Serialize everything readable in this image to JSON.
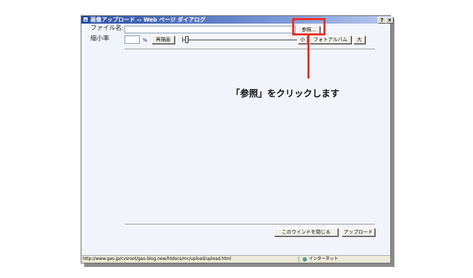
{
  "window": {
    "title": "画像アップロード -- Web ページ ダイアログ",
    "help_button": "?",
    "close_button": "×"
  },
  "form": {
    "file_label": "ファイル名:",
    "file_value": "",
    "browse_label": "参照...",
    "scale_label": "縮小率",
    "scale_value": "",
    "percent_unit": "%",
    "redraw_label": "再描画",
    "small_label": "小",
    "photo_album_label": "フォトアルバム",
    "large_label": "大"
  },
  "footer": {
    "close_window_label": "このウインドを閉じる",
    "upload_label": "アップロード"
  },
  "statusbar": {
    "url": "http://www.gao.jp/cvsroot/gao-blog.new/htdocs/mc/upload/upload.html",
    "zone": "インターネット"
  },
  "annotation": {
    "callout_text": "「参照」をクリックします",
    "highlight_color": "#e8322b"
  }
}
